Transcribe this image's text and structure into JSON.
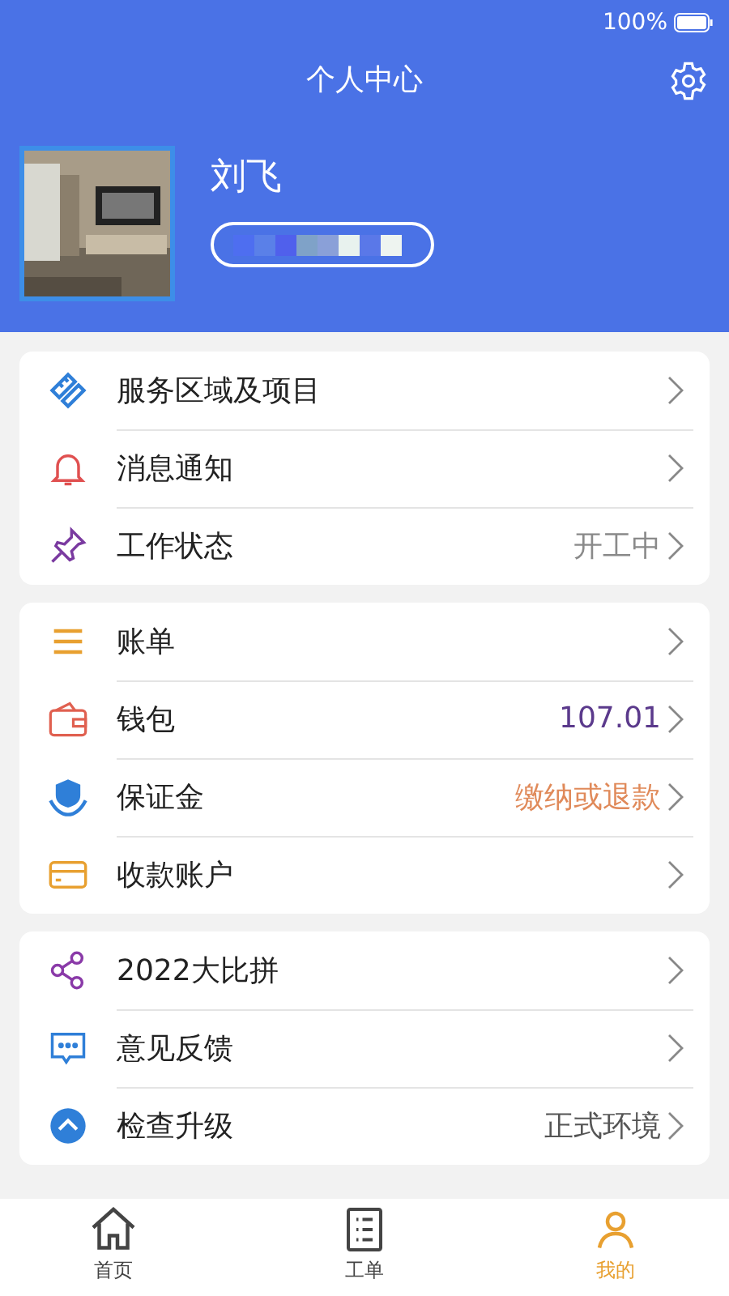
{
  "status_bar": {
    "battery": "100%"
  },
  "header": {
    "title": "个人中心"
  },
  "profile": {
    "name": "刘飞"
  },
  "sections": [
    {
      "items": [
        {
          "label": "服务区域及项目"
        },
        {
          "label": "消息通知"
        },
        {
          "label": "工作状态",
          "value": "开工中",
          "color": "#8a8a8a"
        }
      ]
    },
    {
      "items": [
        {
          "label": "账单"
        },
        {
          "label": "钱包",
          "value": "107.01",
          "color": "#5b3a8c"
        },
        {
          "label": "保证金",
          "value": "缴纳或退款",
          "color": "#e08a5a"
        },
        {
          "label": "收款账户"
        }
      ]
    },
    {
      "items": [
        {
          "label": "2022大比拼"
        },
        {
          "label": "意见反馈"
        },
        {
          "label": "检查升级",
          "value": "正式环境",
          "color": "#555555"
        }
      ]
    }
  ],
  "tabs": [
    {
      "label": "首页",
      "selected": false
    },
    {
      "label": "工单",
      "selected": false
    },
    {
      "label": "我的",
      "selected": true
    }
  ]
}
